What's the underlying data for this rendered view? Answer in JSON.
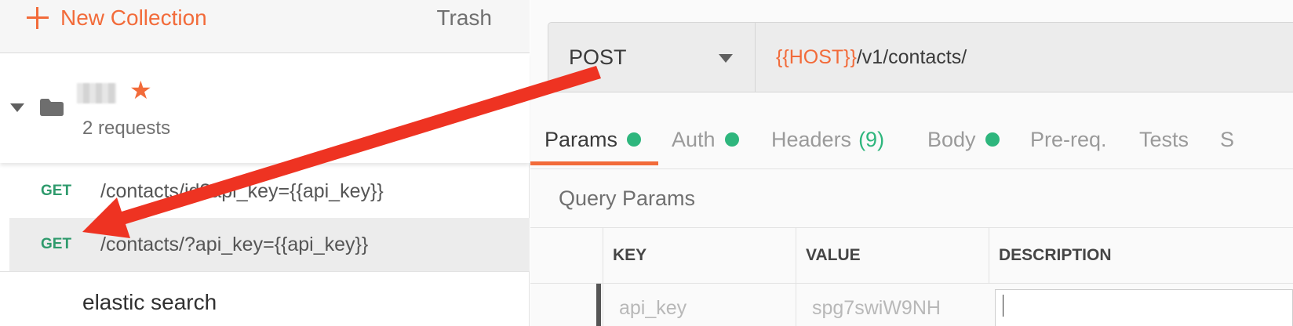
{
  "sidebar": {
    "new_collection_label": "New Collection",
    "trash_label": "Trash",
    "collection": {
      "request_count": "2 requests"
    },
    "requests": [
      {
        "method": "GET",
        "path": "/contacts/id?api_key={{api_key}}"
      },
      {
        "method": "GET",
        "path": "/contacts/?api_key={{api_key}}"
      }
    ],
    "next_item": "elastic search"
  },
  "request": {
    "method": "POST",
    "url_var": "{{HOST}}",
    "url_path": "/v1/contacts/"
  },
  "tabs": {
    "params": "Params",
    "auth": "Auth",
    "headers": "Headers",
    "headers_count": "(9)",
    "body": "Body",
    "prereq": "Pre-req.",
    "tests": "Tests",
    "settings": "S"
  },
  "query_params": {
    "title": "Query Params",
    "columns": [
      "KEY",
      "VALUE",
      "DESCRIPTION"
    ],
    "rows": [
      {
        "key": "api_key",
        "value": "spg7swiW9NH"
      }
    ]
  },
  "colors": {
    "accent": "#f26b3a",
    "method_get": "#2e9a6c",
    "status_dot": "#2eb67d",
    "annotation_arrow": "#ee3322"
  },
  "icons": [
    "plus-icon",
    "caret-down-icon",
    "folder-icon",
    "star-icon",
    "chevron-down-icon"
  ]
}
